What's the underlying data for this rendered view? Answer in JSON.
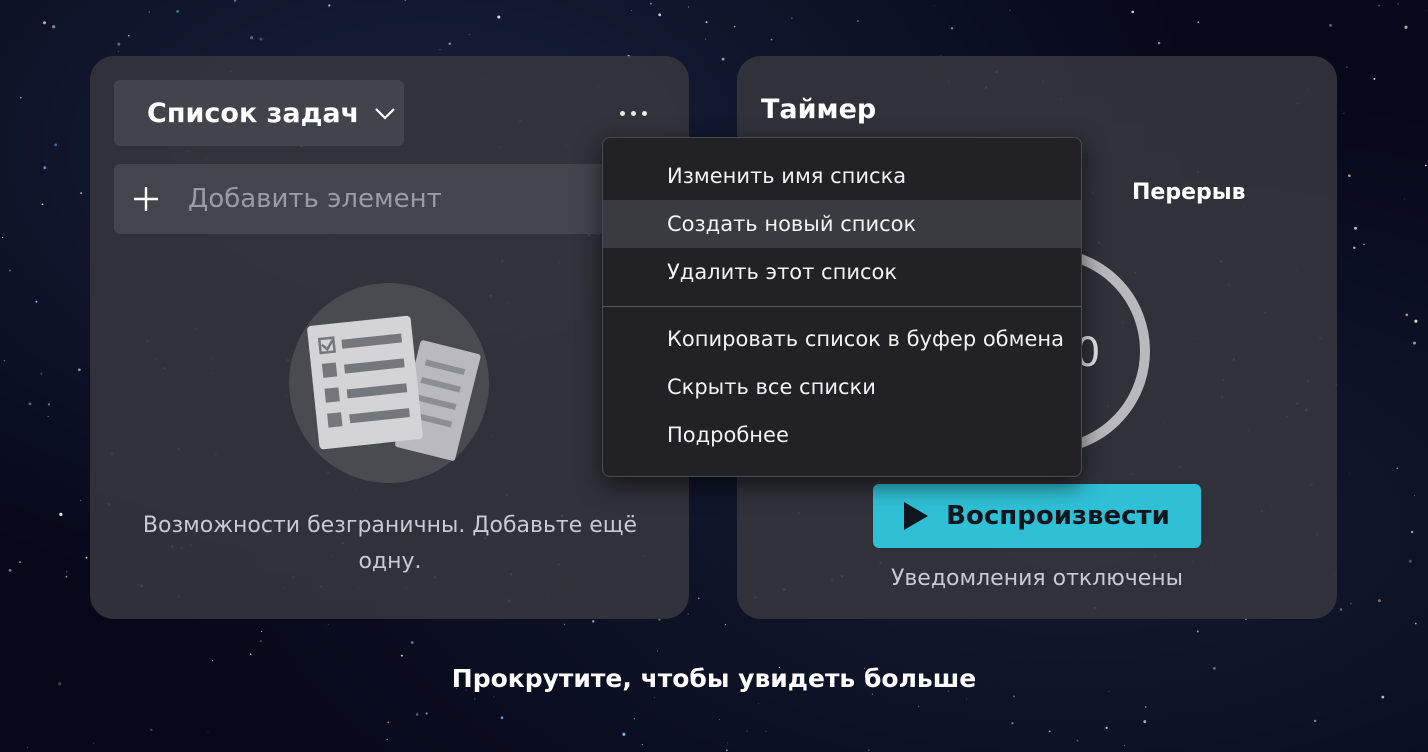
{
  "todo": {
    "title": "Список задач",
    "add_placeholder": "Добавить элемент",
    "empty_text": "Возможности безграничны. Добавьте ещё одну."
  },
  "timer": {
    "title": "Таймер",
    "break_label": "Перерыв",
    "ring_digit": "0",
    "play_label": "Воспроизвести",
    "notifications": "Уведомления отключены"
  },
  "menu": {
    "group1": [
      "Изменить имя списка",
      "Создать новый список",
      "Удалить этот список"
    ],
    "group2": [
      "Копировать список в буфер обмена",
      "Скрыть все списки",
      "Подробнее"
    ],
    "highlighted": "Создать новый список"
  },
  "footer": {
    "scroll_hint": "Прокрутите, чтобы увидеть больше"
  },
  "colors": {
    "accent": "#2fc0d6",
    "card": "#34343c",
    "menu": "#222226"
  },
  "icons": [
    "chevron-down-icon",
    "more-icon",
    "plus-icon",
    "play-icon",
    "checklist-icon"
  ]
}
